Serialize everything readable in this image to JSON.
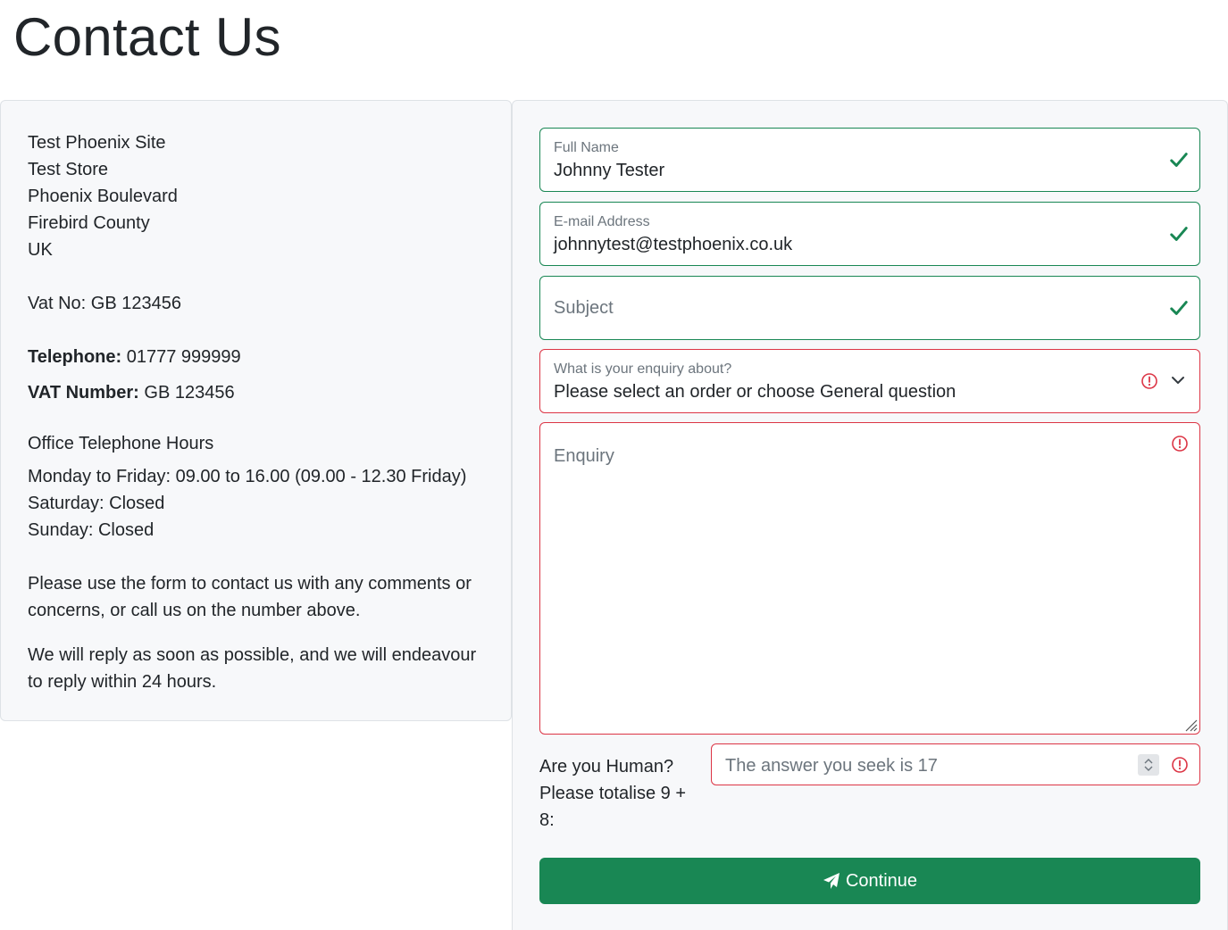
{
  "page": {
    "title": "Contact Us"
  },
  "info": {
    "address": [
      "Test Phoenix Site",
      "Test Store",
      "Phoenix Boulevard",
      "Firebird County",
      "UK"
    ],
    "vat_line": "Vat No: GB 123456",
    "telephone_label": "Telephone:",
    "telephone_value": "01777 999999",
    "vat_number_label": "VAT Number:",
    "vat_number_value": "GB 123456",
    "hours_heading": "Office Telephone Hours",
    "hours": [
      "Monday to Friday: 09.00 to 16.00 (09.00 - 12.30 Friday)",
      "Saturday: Closed",
      "Sunday: Closed"
    ],
    "paragraph1": "Please use the form to contact us with any comments or concerns, or call us on the number above.",
    "paragraph2": "We will reply as soon as possible, and we will endeavour to reply within 24 hours."
  },
  "form": {
    "full_name": {
      "label": "Full Name",
      "value": "Johnny Tester"
    },
    "email": {
      "label": "E-mail Address",
      "value": "johnnytest@testphoenix.co.uk"
    },
    "subject": {
      "placeholder": "Subject"
    },
    "enquiry_type": {
      "label": "What is your enquiry about?",
      "selected": "Please select an order or choose General question"
    },
    "enquiry": {
      "placeholder": "Enquiry"
    },
    "human": {
      "label": "Are you Human? Please totalise 9 + 8:",
      "placeholder": "The answer you seek is 17"
    },
    "submit_label": "Continue"
  },
  "colors": {
    "valid": "#198754",
    "invalid": "#dc3545",
    "button": "#198754"
  },
  "icons": [
    "check-icon",
    "alert-icon",
    "chevron-down-icon",
    "send-icon",
    "resize-grip-icon"
  ]
}
